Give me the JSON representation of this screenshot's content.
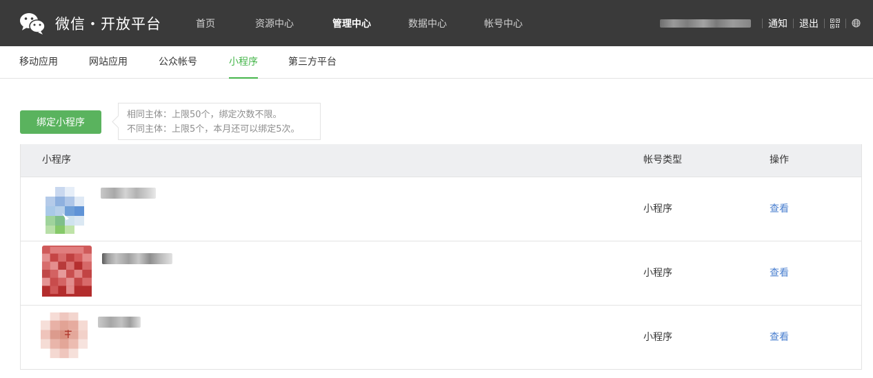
{
  "brand": {
    "name": "微信・开放平台"
  },
  "nav": {
    "items": [
      {
        "label": "首页",
        "active": false
      },
      {
        "label": "资源中心",
        "active": false
      },
      {
        "label": "管理中心",
        "active": true
      },
      {
        "label": "数据中心",
        "active": false
      },
      {
        "label": "帐号中心",
        "active": false
      }
    ]
  },
  "user_bar": {
    "notify_label": "通知",
    "logout_label": "退出",
    "qr_icon": "qr-code-icon",
    "globe_icon": "globe-icon"
  },
  "subnav": {
    "tabs": [
      {
        "label": "移动应用",
        "active": false
      },
      {
        "label": "网站应用",
        "active": false
      },
      {
        "label": "公众帐号",
        "active": false
      },
      {
        "label": "小程序",
        "active": true
      },
      {
        "label": "第三方平台",
        "active": false
      }
    ]
  },
  "bind": {
    "button_label": "绑定小程序",
    "tip_line1": "相同主体：上限50个，绑定次数不限。",
    "tip_line2": "不同主体：上限5个，本月还可以绑定5次。"
  },
  "table": {
    "columns": {
      "name": "小程序",
      "type": "帐号类型",
      "action": "操作"
    },
    "rows": [
      {
        "type": "小程序",
        "action": "查看"
      },
      {
        "type": "小程序",
        "action": "查看"
      },
      {
        "type": "小程序",
        "action": "查看"
      }
    ]
  },
  "colors": {
    "topbar_bg": "#3a3a3a",
    "accent_green": "#44b549",
    "button_green": "#5ab35e",
    "link_blue": "#4a7fcf"
  }
}
